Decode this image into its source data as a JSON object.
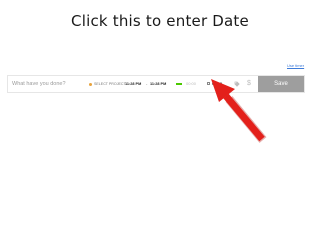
{
  "slide": {
    "title": "Click this to enter Date"
  },
  "tracker": {
    "use_timer_link": "Use timer",
    "description_placeholder": "What have you done?",
    "project_label": "SELECT PROJECT",
    "start_time": "11:28 PM",
    "time_separator": "-",
    "end_time": "11:28 PM",
    "duration": "00:00",
    "date": "04/23",
    "billable_symbol": "$",
    "save_label": "Save"
  },
  "icons": {
    "project": "project-dot-icon",
    "calendar": "calendar-icon",
    "tag": "tag-icon",
    "billable": "dollar-icon",
    "arrow": "red-arrow-icon"
  },
  "colors": {
    "project_dot": "#e8a33d",
    "duration_bar": "#4bc800",
    "save_button": "#9e9e9e",
    "arrow": "#e3201b",
    "link": "#3d7bd9"
  }
}
